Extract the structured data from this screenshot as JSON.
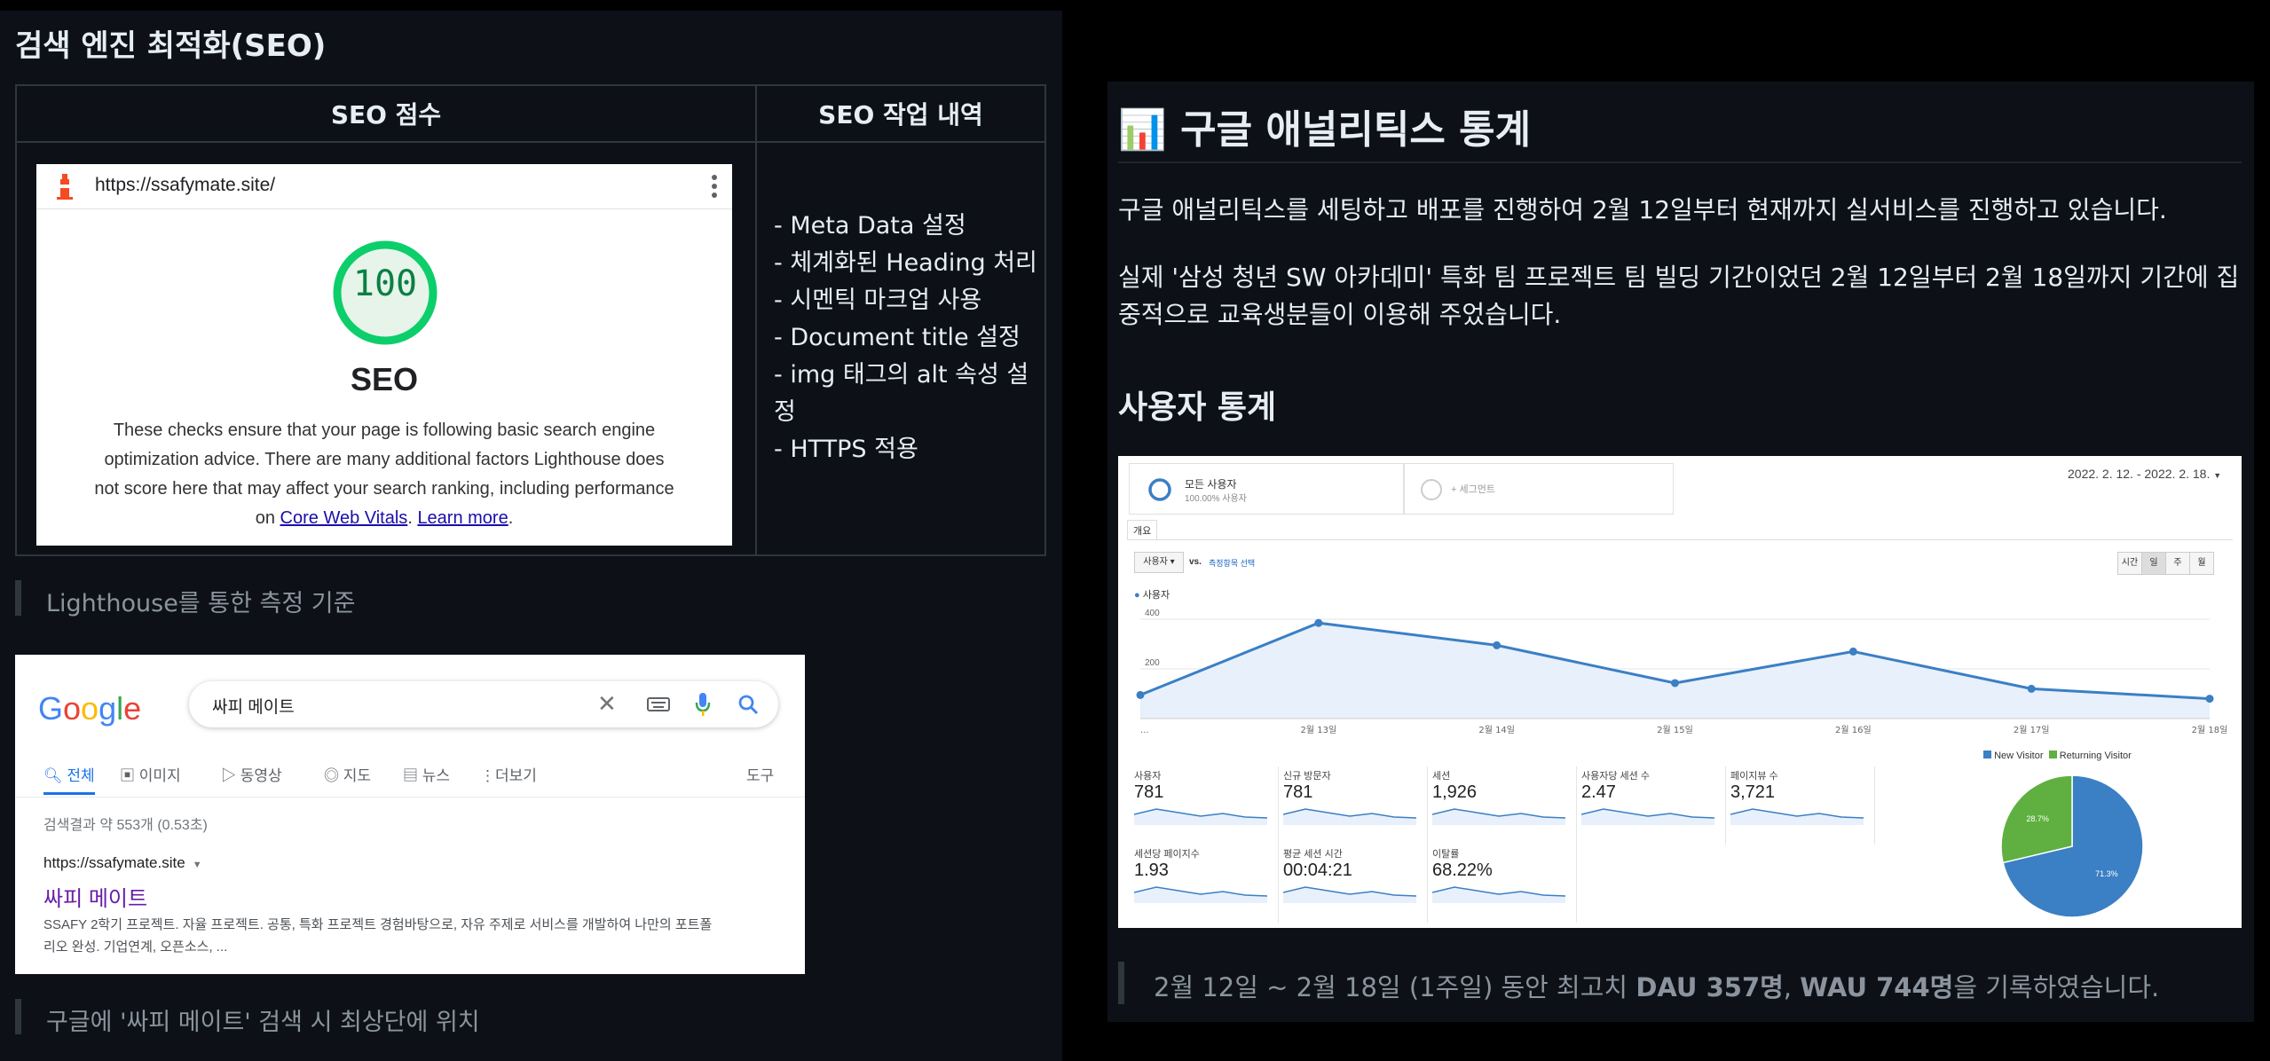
{
  "left": {
    "section_title": "검색 엔진 최적화(SEO)",
    "table": {
      "col1_header": "SEO 점수",
      "col2_header": "SEO 작업 내역"
    },
    "lighthouse": {
      "url": "https://ssafymate.site/",
      "score": "100",
      "category": "SEO",
      "desc_main": "These checks ensure that your page is following basic search engine optimization advice. There are many additional factors Lighthouse does not score here that may affect your search ranking, including performance on ",
      "link1": "Core Web Vitals",
      "sep": ". ",
      "link2": "Learn more",
      "end": "."
    },
    "work_items": [
      "- Meta Data 설정",
      "- 체계화된 Heading 처리",
      "- 시멘틱 마크업 사용",
      "- Document title 설정",
      "- img 태그의 alt 속성 설정",
      "- HTTPS 적용"
    ],
    "quote1": "Lighthouse를 통한 측정 기준",
    "google": {
      "logo": "Google",
      "query": "싸피 메이트",
      "tabs": [
        "전체",
        "이미지",
        "동영상",
        "지도",
        "뉴스",
        "더보기"
      ],
      "tools": "도구",
      "result_count": "검색결과 약 553개 (0.53초)",
      "cite": "https://ssafymate.site",
      "title": "싸피 메이트",
      "snippet": "SSAFY 2학기 프로젝트. 자율 프로젝트. 공통, 특화 프로젝트 경험바탕으로, 자유 주제로 서비스를 개발하여 나만의 포트폴리오 완성. 기업연계, 오픈소스, ..."
    },
    "quote2": "구글에 '싸피 메이트' 검색 시 최상단에 위치"
  },
  "right": {
    "title_icon": "📊",
    "title": "구글 애널리틱스 통계",
    "para1": "구글 애널리틱스를 세팅하고 배포를 진행하여 2월 12일부터 현재까지 실서비스를 진행하고 있습니다.",
    "para2": "실제 '삼성 청년 SW 아카데미' 특화 팀 프로젝트 팀 빌딩 기간이었던 2월 12일부터 2월 18일까지 기간에 집중적으로 교육생분들이 이용해 주었습니다.",
    "subtitle": "사용자 통계",
    "ga": {
      "segment1_name": "모든 사용자",
      "segment1_sub": "100.00% 사용자",
      "segment2": "+ 세그먼트",
      "date_range": "2022. 2. 12. - 2022. 2. 18.",
      "tab": "개요",
      "dropdown": "사용자",
      "vs": "vs.",
      "select_metric": "측정항목 선택",
      "period_buttons": [
        "시간",
        "일",
        "주",
        "월"
      ],
      "legend_series": "사용자",
      "metrics": [
        {
          "label": "사용자",
          "value": "781"
        },
        {
          "label": "신규 방문자",
          "value": "781"
        },
        {
          "label": "세션",
          "value": "1,926"
        },
        {
          "label": "사용자당 세션 수",
          "value": "2.47"
        },
        {
          "label": "페이지뷰 수",
          "value": "3,721"
        },
        {
          "label": "세션당 페이지수",
          "value": "1.93"
        },
        {
          "label": "평균 세션 시간",
          "value": "00:04:21"
        },
        {
          "label": "이탈률",
          "value": "68.22%"
        }
      ],
      "pie_legend": [
        "New Visitor",
        "Returning Visitor"
      ]
    },
    "chart_data": [
      {
        "type": "area",
        "categories": [
          "...",
          "2월 13일",
          "2월 14일",
          "2월 15일",
          "2월 16일",
          "2월 17일",
          "2월 18일"
        ],
        "series": [
          {
            "name": "사용자",
            "values": [
              95,
              385,
              295,
              143,
              270,
              120,
              80
            ]
          }
        ],
        "ylim": [
          0,
          450
        ],
        "yticks": [
          200,
          400
        ],
        "grid": true,
        "line_color": "#3b7fc4"
      },
      {
        "type": "pie",
        "labels": [
          "New Visitor",
          "Returning Visitor"
        ],
        "values": [
          71.3,
          28.7
        ],
        "value_labels": [
          "71.3%",
          "28.7%"
        ],
        "colors": [
          "#3b7fc4",
          "#5fb040"
        ],
        "legend": "top"
      }
    ],
    "quote": {
      "pre": "2월 12일 ~ 2월 18일 (1주일) 동안 최고치 ",
      "bold1": "DAU 357명",
      "mid": ", ",
      "bold2": "WAU 744명",
      "post": "을 기록하였습니다."
    }
  }
}
